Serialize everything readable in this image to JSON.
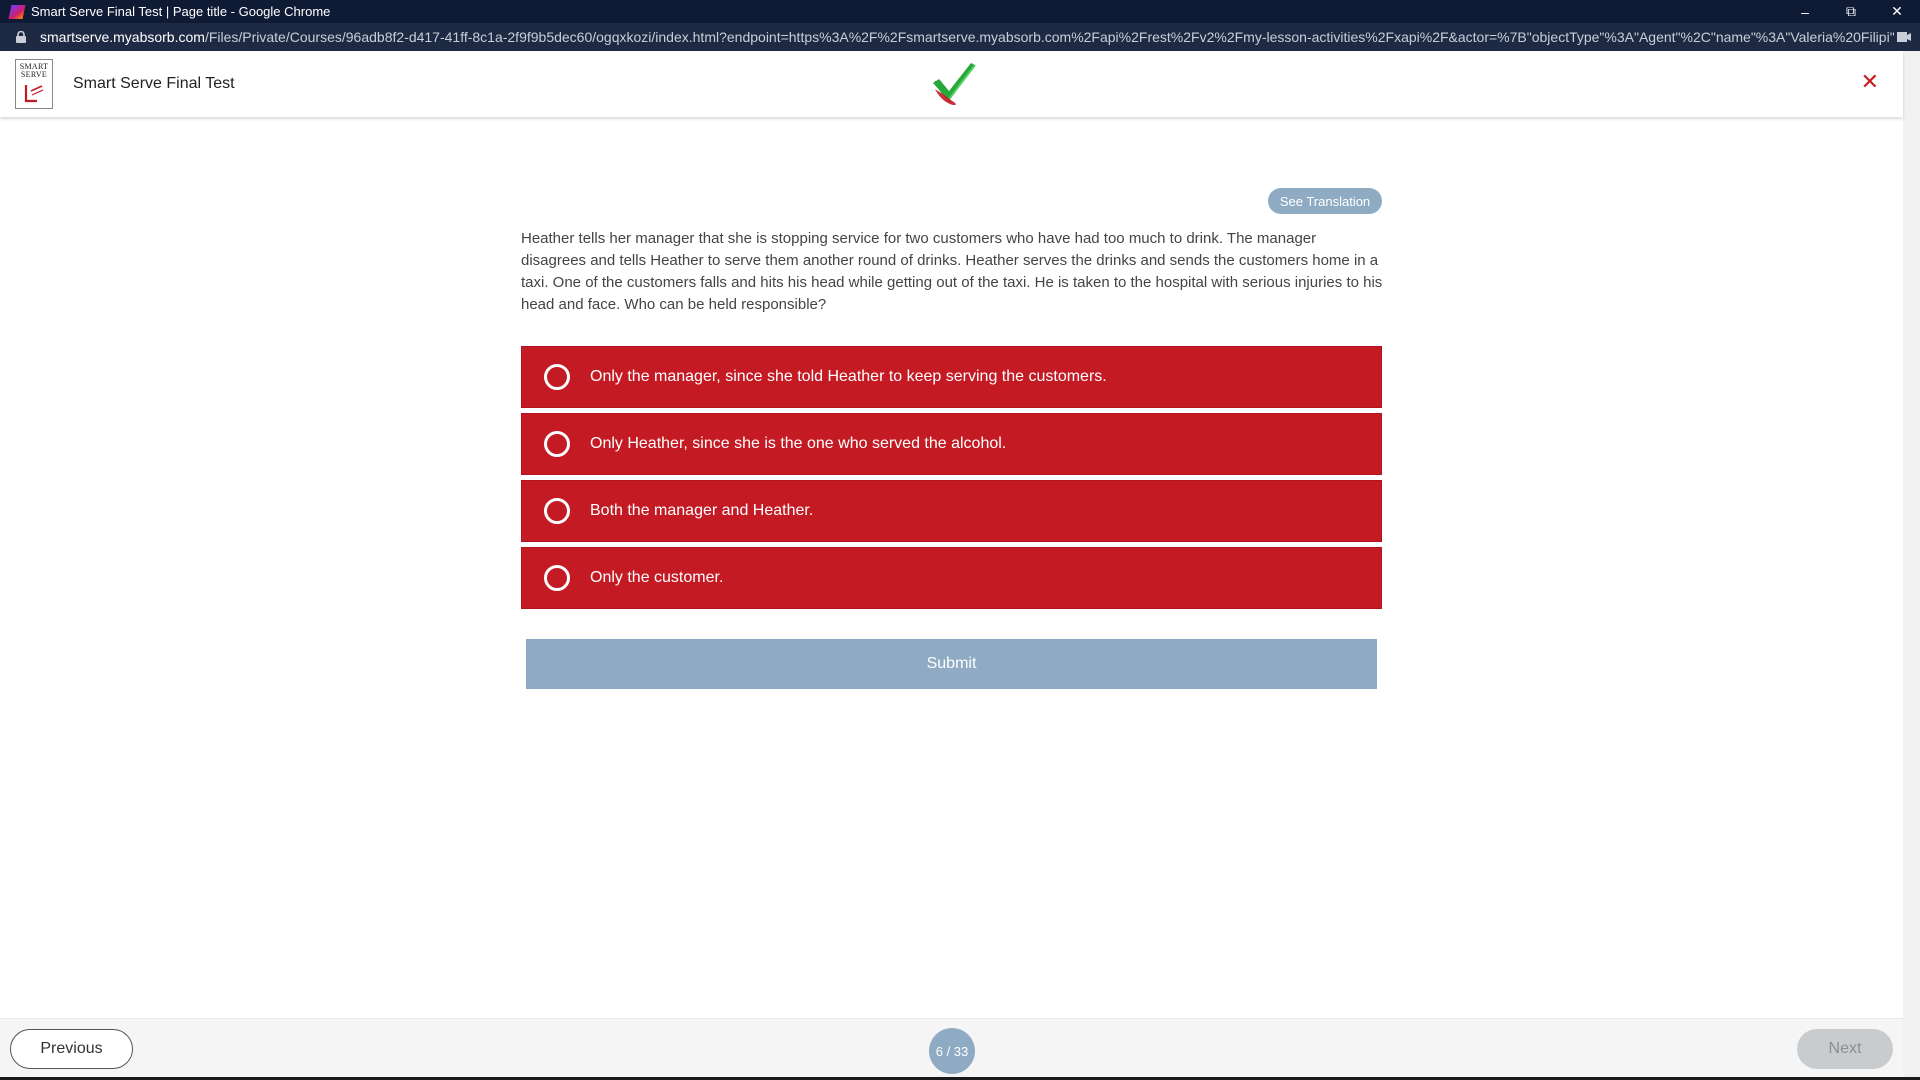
{
  "browser": {
    "window_title": "Smart Serve Final Test | Page title - Google Chrome",
    "url_host": "smartserve.myabsorb.com",
    "url_path": "/Files/Private/Courses/96adb8f2-d417-41ff-8c1a-2f9f9b5dec60/ogqxkozi/index.html?endpoint=https%3A%2F%2Fsmartserve.myabsorb.com%2Fapi%2Frest%2Fv2%2Fmy-lesson-activities%2Fxapi%2F&actor=%7B\"objectType\"%3A\"Agent\"%2C\"name\"%3A\"Valeria%20Filipi\"%..."
  },
  "header": {
    "logo_line1": "SMART",
    "logo_line2": "SERVE",
    "title": "Smart Serve Final Test",
    "close_symbol": "✕"
  },
  "question": {
    "translate_label": "See Translation",
    "text": "Heather tells her manager that she is stopping service for two customers who have had too much to drink. The manager disagrees and tells Heather to serve them another round of drinks. Heather serves the drinks and sends the customers home in a taxi. One of the customers falls and hits his head while getting out of the taxi. He is taken to the hospital with serious injuries to his head and face. Who can be held responsible?",
    "options": [
      "Only the manager, since she told Heather to keep serving the customers.",
      "Only Heather, since she is the one who served the alcohol.",
      "Both the manager and Heather.",
      "Only the customer."
    ],
    "submit_label": "Submit"
  },
  "footer": {
    "previous_label": "Previous",
    "page_indicator": "6 / 33",
    "next_label": "Next"
  },
  "colors": {
    "option_red": "#c41a24",
    "accent_blue": "#8eabc3",
    "close_red": "#cc1a24"
  }
}
